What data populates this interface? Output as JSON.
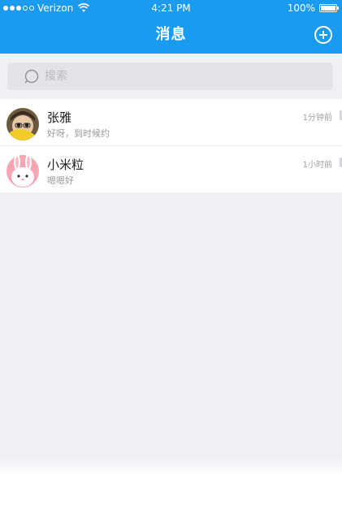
{
  "status_bar": {
    "carrier": "Verizon",
    "time": "4:21 PM",
    "battery": "100%"
  },
  "nav": {
    "title": "消息"
  },
  "search": {
    "placeholder": "搜索"
  },
  "conversations": [
    {
      "name": "张雅",
      "preview": "好呀，到时候约",
      "time": "1分钟前"
    },
    {
      "name": "小米粒",
      "preview": "嗯嗯好",
      "time": "1小时前"
    }
  ],
  "colors": {
    "brand_blue": "#1a9bf0",
    "background": "#efeff4",
    "search_bg": "#e3e4ea"
  }
}
